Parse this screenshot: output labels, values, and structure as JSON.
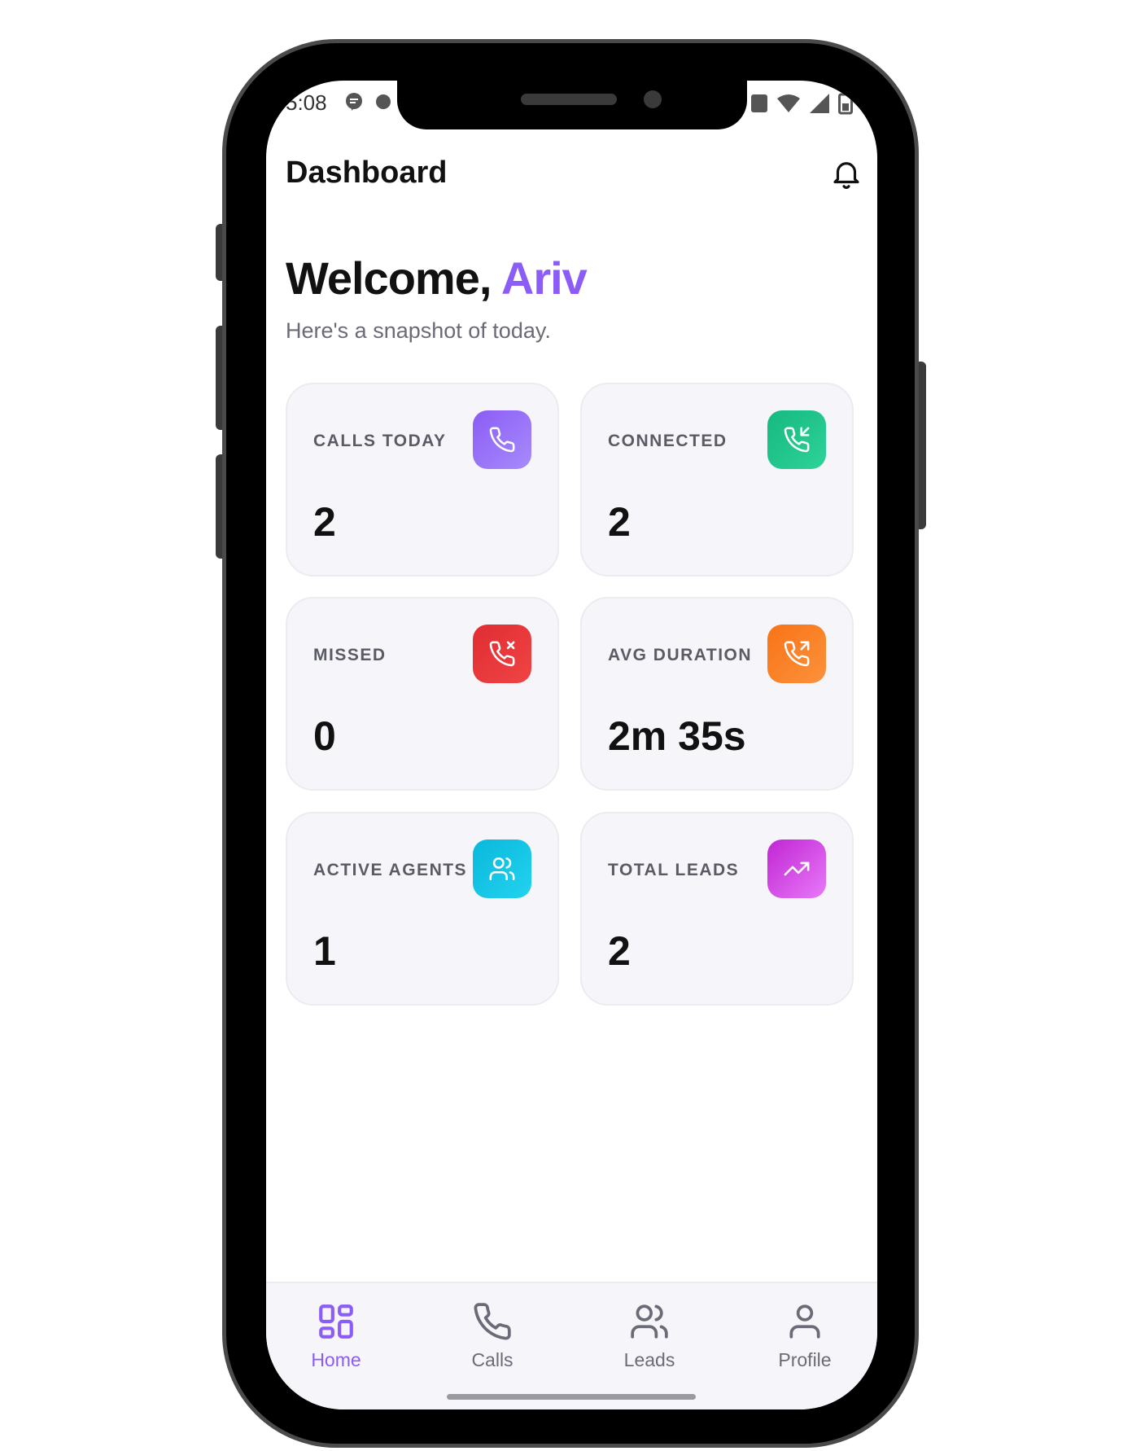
{
  "status_bar": {
    "time": "5:08"
  },
  "header": {
    "title": "Dashboard"
  },
  "welcome": {
    "greeting": "Welcome,",
    "name": "Ariv",
    "subtitle": "Here's a snapshot of today."
  },
  "stats": [
    {
      "label": "CALLS TODAY",
      "value": "2",
      "icon": "phone-icon",
      "color": "#8b5cf6"
    },
    {
      "label": "CONNECTED",
      "value": "2",
      "icon": "phone-incoming-icon",
      "color": "#1fc28a"
    },
    {
      "label": "MISSED",
      "value": "0",
      "icon": "phone-missed-icon",
      "color": "#e5353b"
    },
    {
      "label": "AVG DURATION",
      "value": "2m 35s",
      "icon": "phone-outgoing-icon",
      "color": "#fb7a1f"
    },
    {
      "label": "ACTIVE AGENTS",
      "value": "1",
      "icon": "users-icon",
      "color": "#16c3e6"
    },
    {
      "label": "TOTAL LEADS",
      "value": "2",
      "icon": "trending-up-icon",
      "color": "#d63ee8"
    }
  ],
  "nav": {
    "items": [
      {
        "label": "Home",
        "icon": "grid-icon",
        "active": true
      },
      {
        "label": "Calls",
        "icon": "phone-icon",
        "active": false
      },
      {
        "label": "Leads",
        "icon": "users-icon",
        "active": false
      },
      {
        "label": "Profile",
        "icon": "user-icon",
        "active": false
      }
    ],
    "active_color": "#8b5cf6"
  }
}
